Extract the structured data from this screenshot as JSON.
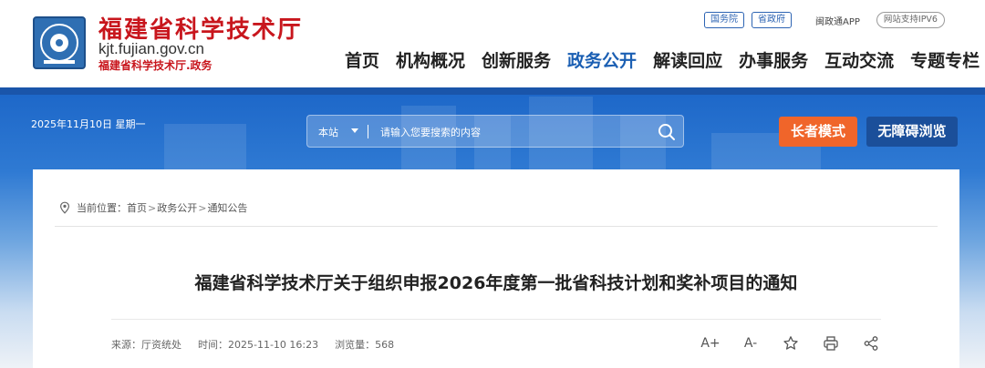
{
  "header": {
    "site_title": "福建省科学技术厅",
    "domain": "kjt.fujian.gov.cn",
    "subtitle": "福建省科学技术厅.政务",
    "top_links": [
      "国务院",
      "省政府"
    ],
    "app_link": "闽政通APP",
    "ipv6_badge": "网站支持IPV6"
  },
  "nav": {
    "items": [
      "首页",
      "机构概况",
      "创新服务",
      "政务公开",
      "解读回应",
      "办事服务",
      "互动交流",
      "专题专栏"
    ],
    "active_index": 3
  },
  "banner": {
    "date": "2025年11月10日 星期一",
    "search_scope": "本站",
    "search_placeholder": "请输入您要搜索的内容",
    "elder_mode": "长者模式",
    "accessible": "无障碍浏览"
  },
  "breadcrumb": {
    "label": "当前位置：",
    "items": [
      "首页",
      "政务公开",
      "通知公告"
    ]
  },
  "article": {
    "title": "福建省科学技术厅关于组织申报2026年度第一批省科技计划和奖补项目的通知",
    "source": "来源：厅资统处",
    "time": "时间：2025-11-10 16:23",
    "views": "浏览量：568"
  },
  "tools": {
    "font_larger": "A+",
    "font_smaller": "A-",
    "icons": [
      "star-icon",
      "print-icon",
      "share-icon"
    ]
  },
  "colors": {
    "brand_red": "#c8161d",
    "nav_active": "#1b5fb3",
    "elder_button": "#f0652a",
    "accessible_button": "#1b4f9a"
  }
}
